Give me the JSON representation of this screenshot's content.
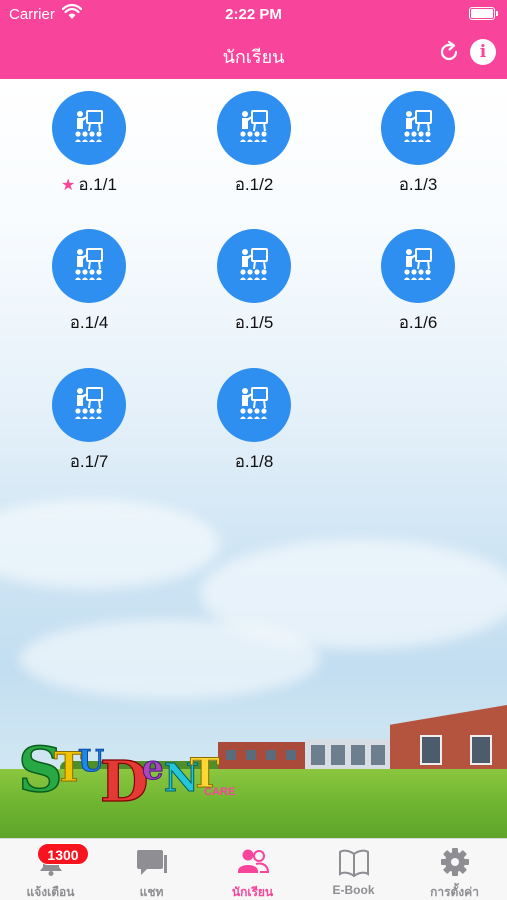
{
  "status_bar": {
    "carrier": "Carrier",
    "time": "2:22 PM"
  },
  "nav": {
    "title": "นักเรียน",
    "refresh_icon": "refresh-icon",
    "info_icon": "info-icon"
  },
  "classes": [
    {
      "label": "อ.1/1",
      "favorite": true
    },
    {
      "label": "อ.1/2",
      "favorite": false
    },
    {
      "label": "อ.1/3",
      "favorite": false
    },
    {
      "label": "อ.1/4",
      "favorite": false
    },
    {
      "label": "อ.1/5",
      "favorite": false
    },
    {
      "label": "อ.1/6",
      "favorite": false
    },
    {
      "label": "อ.1/7",
      "favorite": false
    },
    {
      "label": "อ.1/8",
      "favorite": false
    }
  ],
  "logo": {
    "text": "STUDENT CARE"
  },
  "tabbar": {
    "items": [
      {
        "label": "แจ้งเตือน",
        "icon": "bell-icon",
        "badge": "1300"
      },
      {
        "label": "แชท",
        "icon": "chat-icon"
      },
      {
        "label": "นักเรียน",
        "icon": "students-icon",
        "active": true
      },
      {
        "label": "E-Book",
        "icon": "book-icon"
      },
      {
        "label": "การตั้งค่า",
        "icon": "gear-icon"
      }
    ]
  },
  "colors": {
    "brand": "#f9449b",
    "class_circle": "#2e8ff0",
    "badge": "#f8141f",
    "tab_inactive": "#8e8e93"
  }
}
